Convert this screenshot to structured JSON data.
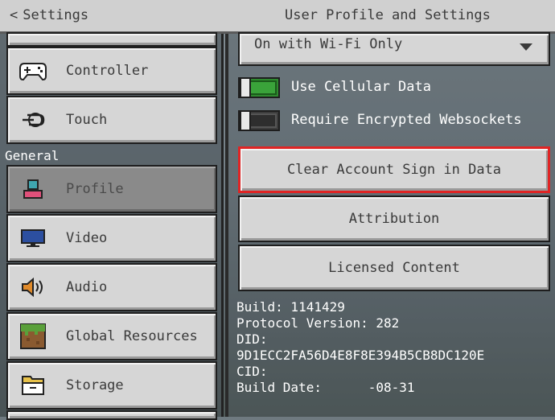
{
  "header": {
    "back_label": "Settings",
    "back_glyph": "<",
    "title": "User Profile and Settings"
  },
  "sidebar": {
    "section_general": "General",
    "items": [
      {
        "label": "Controller",
        "icon": "controller-icon"
      },
      {
        "label": "Touch",
        "icon": "touch-icon"
      },
      {
        "label": "Profile",
        "icon": "profile-icon",
        "selected": true
      },
      {
        "label": "Video",
        "icon": "video-icon"
      },
      {
        "label": "Audio",
        "icon": "audio-icon"
      },
      {
        "label": "Global Resources",
        "icon": "global-resources-icon"
      },
      {
        "label": "Storage",
        "icon": "storage-icon"
      }
    ]
  },
  "settings": {
    "network_dropdown_value": "On with Wi-Fi Only",
    "use_cellular_label": "Use Cellular Data",
    "use_cellular_on": true,
    "encrypted_ws_label": "Require Encrypted Websockets",
    "encrypted_ws_on": false,
    "clear_account_button": "Clear Account Sign in Data",
    "attribution_button": "Attribution",
    "licensed_content_button": "Licensed Content"
  },
  "build_info": {
    "build": "Build: 1141429",
    "protocol": "Protocol Version: 282",
    "did_label": "DID:",
    "did_value": "9D1ECC2FA56D4E8F8E394B5CB8DC120E",
    "cid_label": "CID:",
    "build_date": "Build Date:      -08-31"
  },
  "colors": {
    "toggle_on": "#3aa33a",
    "highlight_border": "#e02424",
    "button_bg": "#d6d6d6"
  }
}
